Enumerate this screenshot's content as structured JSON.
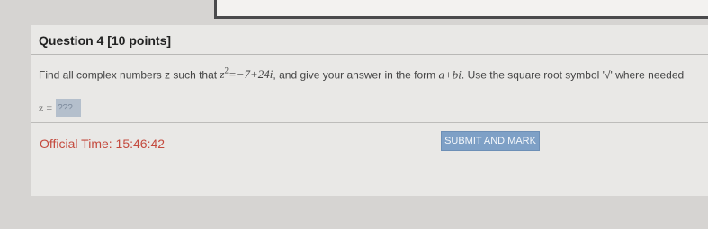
{
  "question": {
    "title": "Question 4 [10 points]",
    "text_prefix": "Find all complex numbers z such that ",
    "equation_var": "z",
    "equation_exp": "2",
    "equation_rhs": "=−7+24i",
    "text_middle": ", and give your answer in the form ",
    "answer_form": "a+bi",
    "text_suffix": ". Use the square root symbol '√' where needed"
  },
  "answer": {
    "label": "z =",
    "value": "???"
  },
  "footer": {
    "official_time_label": "Official Time:",
    "official_time_value": "15:46:42",
    "submit_label": "SUBMIT AND MARK"
  },
  "colors": {
    "time_text": "#c44a3e",
    "submit_bg": "#7ea0c6",
    "input_bg": "#b4bfcc"
  }
}
